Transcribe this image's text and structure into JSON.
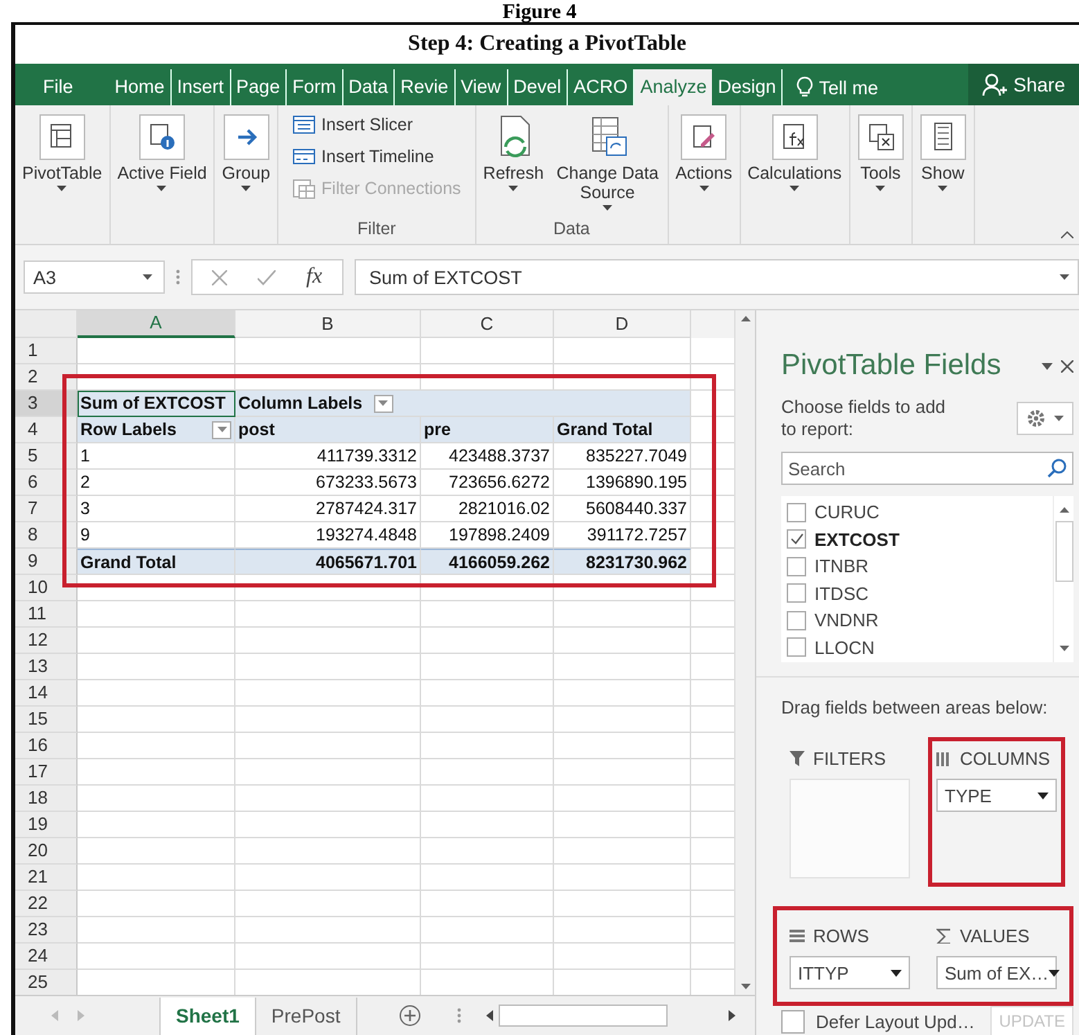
{
  "caption": "Figure 4",
  "title": "Step 4: Creating a PivotTable",
  "ribbon_tabs": [
    {
      "label": "File",
      "selected": false
    },
    {
      "label": "Home",
      "selected": false
    },
    {
      "label": "Insert",
      "selected": false
    },
    {
      "label": "Page",
      "selected": false
    },
    {
      "label": "Form",
      "selected": false
    },
    {
      "label": "Data",
      "selected": false
    },
    {
      "label": "Revie",
      "selected": false
    },
    {
      "label": "View",
      "selected": false
    },
    {
      "label": "Devel",
      "selected": false
    },
    {
      "label": "ACRO",
      "selected": false
    },
    {
      "label": "Analyze",
      "selected": true
    },
    {
      "label": "Design",
      "selected": false
    }
  ],
  "tell_me": "Tell me",
  "share": "Share",
  "ribbon_groups": [
    {
      "buttons": [
        {
          "label": "PivotTable",
          "dropdown": true
        }
      ]
    },
    {
      "buttons": [
        {
          "label": "Active Field",
          "dropdown": true
        }
      ]
    },
    {
      "buttons": [
        {
          "label": "Group",
          "dropdown": true
        }
      ]
    },
    {
      "label": "Filter",
      "small_buttons": [
        {
          "label": "Insert Slicer",
          "disabled": false
        },
        {
          "label": "Insert Timeline",
          "disabled": false
        },
        {
          "label": "Filter Connections",
          "disabled": true
        }
      ]
    },
    {
      "label": "Data",
      "buttons": [
        {
          "label": "Refresh",
          "dropdown": true
        },
        {
          "label": "Change Data Source",
          "dropdown": true
        }
      ]
    },
    {
      "buttons": [
        {
          "label": "Actions",
          "dropdown": true
        }
      ]
    },
    {
      "buttons": [
        {
          "label": "Calculations",
          "dropdown": true
        }
      ]
    },
    {
      "buttons": [
        {
          "label": "Tools",
          "dropdown": true
        }
      ]
    },
    {
      "buttons": [
        {
          "label": "Show",
          "dropdown": true
        }
      ]
    }
  ],
  "formula_bar": {
    "name_box": "A3",
    "function_label": "fx",
    "formula": "Sum of EXTCOST"
  },
  "sheet": {
    "highlighted": true,
    "columns": [
      {
        "label": "A",
        "selected": true
      },
      {
        "label": "B",
        "selected": false
      },
      {
        "label": "C",
        "selected": false
      },
      {
        "label": "D",
        "selected": false
      }
    ],
    "rows": [
      {
        "number": "1",
        "selected": false
      },
      {
        "number": "2",
        "selected": false
      },
      {
        "number": "3",
        "selected": true,
        "kind": "header",
        "cells": [
          {
            "text": "Sum of EXTCOST",
            "selected": true,
            "filter": false
          },
          {
            "text": "Column Labels",
            "selected": false,
            "filter": true
          }
        ]
      },
      {
        "number": "4",
        "selected": false,
        "kind": "labels",
        "cells": [
          {
            "text": "Row Labels",
            "selected": false,
            "filter": true
          },
          {
            "text": "post",
            "selected": false,
            "filter": false
          },
          {
            "text": "pre",
            "selected": false,
            "filter": false
          },
          {
            "text": "Grand Total",
            "selected": false,
            "filter": false
          }
        ]
      },
      {
        "number": "5",
        "selected": false,
        "kind": "data",
        "cells": [
          {
            "text": "1",
            "selected": false,
            "filter": false
          },
          {
            "text": "411739.3312",
            "selected": false,
            "filter": false
          },
          {
            "text": "423488.3737",
            "selected": false,
            "filter": false
          },
          {
            "text": "835227.7049",
            "selected": false,
            "filter": false
          }
        ]
      },
      {
        "number": "6",
        "selected": false,
        "kind": "data",
        "cells": [
          {
            "text": "2",
            "selected": false,
            "filter": false
          },
          {
            "text": "673233.5673",
            "selected": false,
            "filter": false
          },
          {
            "text": "723656.6272",
            "selected": false,
            "filter": false
          },
          {
            "text": "1396890.195",
            "selected": false,
            "filter": false
          }
        ]
      },
      {
        "number": "7",
        "selected": false,
        "kind": "data",
        "cells": [
          {
            "text": "3",
            "selected": false,
            "filter": false
          },
          {
            "text": "2787424.317",
            "selected": false,
            "filter": false
          },
          {
            "text": "2821016.02",
            "selected": false,
            "filter": false
          },
          {
            "text": "5608440.337",
            "selected": false,
            "filter": false
          }
        ]
      },
      {
        "number": "8",
        "selected": false,
        "kind": "data",
        "cells": [
          {
            "text": "9",
            "selected": false,
            "filter": false
          },
          {
            "text": "193274.4848",
            "selected": false,
            "filter": false
          },
          {
            "text": "197898.2409",
            "selected": false,
            "filter": false
          },
          {
            "text": "391172.7257",
            "selected": false,
            "filter": false
          }
        ]
      },
      {
        "number": "9",
        "selected": false,
        "kind": "total",
        "cells": [
          {
            "text": "Grand Total",
            "selected": false,
            "filter": false
          },
          {
            "text": "4065671.701",
            "selected": false,
            "filter": false
          },
          {
            "text": "4166059.262",
            "selected": false,
            "filter": false
          },
          {
            "text": "8231730.962",
            "selected": false,
            "filter": false
          }
        ]
      },
      {
        "number": "10",
        "selected": false
      },
      {
        "number": "11",
        "selected": false
      },
      {
        "number": "12",
        "selected": false
      },
      {
        "number": "13",
        "selected": false
      },
      {
        "number": "14",
        "selected": false
      },
      {
        "number": "15",
        "selected": false
      },
      {
        "number": "16",
        "selected": false
      },
      {
        "number": "17",
        "selected": false
      },
      {
        "number": "18",
        "selected": false
      },
      {
        "number": "19",
        "selected": false
      },
      {
        "number": "20",
        "selected": false
      },
      {
        "number": "21",
        "selected": false
      },
      {
        "number": "22",
        "selected": false
      },
      {
        "number": "23",
        "selected": false
      },
      {
        "number": "24",
        "selected": false
      },
      {
        "number": "25",
        "selected": false
      }
    ]
  },
  "sheet_tabs": [
    {
      "label": "Sheet1",
      "selected": true
    },
    {
      "label": "PrePost",
      "selected": false
    }
  ],
  "field_pane": {
    "title": "PivotTable Fields",
    "subtitle": "Choose fields to add to report:",
    "search": {
      "placeholder": "Search"
    },
    "fields": [
      {
        "label": "CURUC",
        "checked": false
      },
      {
        "label": "EXTCOST",
        "checked": true
      },
      {
        "label": "ITNBR",
        "checked": false
      },
      {
        "label": "ITDSC",
        "checked": false
      },
      {
        "label": "VNDNR",
        "checked": false
      },
      {
        "label": "LLOCN",
        "checked": false
      }
    ],
    "areas_hint": "Drag fields between areas below:",
    "area_rows": [
      {
        "highlighted": false,
        "areas": [
          {
            "kind": "filters",
            "label": "FILTERS",
            "highlighted": false
          },
          {
            "kind": "columns",
            "label": "COLUMNS",
            "field": "TYPE",
            "highlighted": true
          }
        ]
      },
      {
        "highlighted": true,
        "areas": [
          {
            "kind": "rows",
            "label": "ROWS",
            "field": "ITTYP",
            "highlighted": false
          },
          {
            "kind": "values",
            "label": "VALUES",
            "field": "Sum of EX…",
            "highlighted": false
          }
        ]
      }
    ],
    "defer": {
      "label": "Defer Layout Upd…",
      "checked": false
    },
    "update": {
      "label": "UPDATE",
      "disabled": true
    }
  }
}
